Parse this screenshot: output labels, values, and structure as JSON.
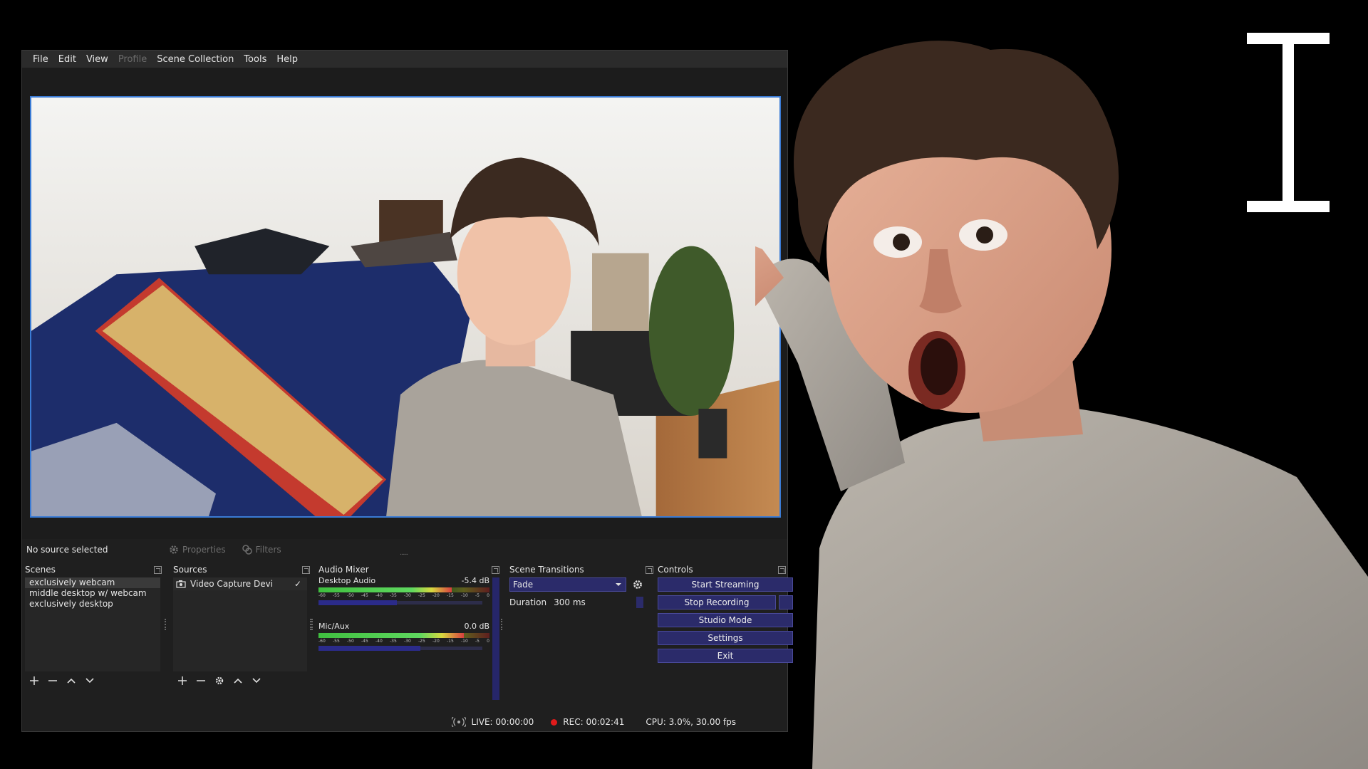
{
  "menubar": {
    "items": [
      {
        "label": "File",
        "disabled": false
      },
      {
        "label": "Edit",
        "disabled": false
      },
      {
        "label": "View",
        "disabled": false
      },
      {
        "label": "Profile",
        "disabled": true
      },
      {
        "label": "Scene Collection",
        "disabled": false
      },
      {
        "label": "Tools",
        "disabled": false
      },
      {
        "label": "Help",
        "disabled": false
      }
    ]
  },
  "source_bar": {
    "status": "No source selected",
    "properties_label": "Properties",
    "filters_label": "Filters"
  },
  "scenes": {
    "title": "Scenes",
    "items": [
      "exclusively webcam",
      "middle desktop w/ webcam",
      "exclusively desktop"
    ],
    "selected_index": 0
  },
  "sources": {
    "title": "Sources",
    "items": [
      {
        "label": "Video Capture Devi",
        "visible": true
      }
    ]
  },
  "audio_mixer": {
    "title": "Audio Mixer",
    "channels": [
      {
        "name": "Desktop Audio",
        "db": "-5.4 dB",
        "level": 0.78,
        "volume": 0.48
      },
      {
        "name": "Mic/Aux",
        "db": "0.0 dB",
        "level": 0.85,
        "volume": 0.62
      }
    ],
    "ticks": [
      "-60",
      "-55",
      "-50",
      "-45",
      "-40",
      "-35",
      "-30",
      "-25",
      "-20",
      "-15",
      "-10",
      "-5",
      "0"
    ]
  },
  "transitions": {
    "title": "Scene Transitions",
    "selected": "Fade",
    "duration_label": "Duration",
    "duration_value": "300 ms"
  },
  "controls": {
    "title": "Controls",
    "buttons": [
      "Start Streaming",
      "Stop Recording",
      "Studio Mode",
      "Settings",
      "Exit"
    ]
  },
  "status": {
    "live": "LIVE: 00:00:00",
    "rec": "REC: 00:02:41",
    "cpu": "CPU: 3.0%, 30.00 fps"
  },
  "colors": {
    "accent_blue": "#3a7bd5",
    "button_bg": "#2b2b6a",
    "rec_red": "#e01b1b"
  }
}
